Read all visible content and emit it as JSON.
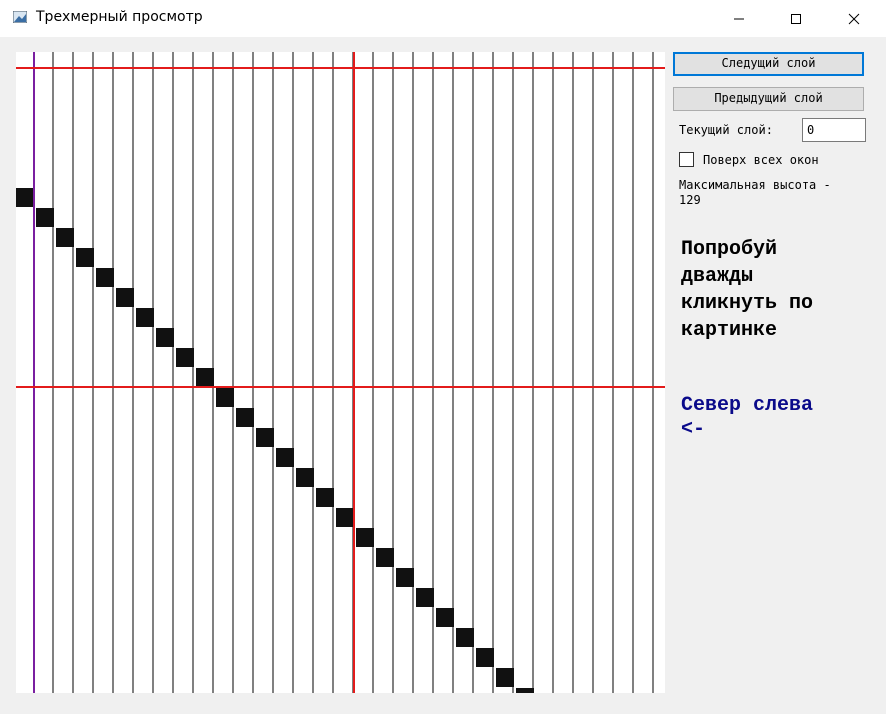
{
  "window": {
    "title": "Трехмерный просмотр",
    "icon": "app-icon",
    "controls": [
      "minimize-icon",
      "maximize-icon",
      "close-icon"
    ]
  },
  "controls": {
    "next_layer_label": "Следущий слой",
    "prev_layer_label": "Предыдущий слой",
    "current_layer_label": "Текущий слой:",
    "current_layer_value": "0",
    "topmost_label": "Поверх всех окон",
    "topmost_checked": false,
    "max_height_text": "Максимальная высота -\n129"
  },
  "hints": {
    "double_click_text": "Попробуй\nдважды\nкликнуть по\nкартинке",
    "north_text": "Север слева\n<-"
  },
  "colors": {
    "grid_line": "#000000",
    "marker_red": "#e31b1b",
    "marker_purple": "#7a1fa0",
    "block": "#111111",
    "accent": "#0078d7"
  }
}
